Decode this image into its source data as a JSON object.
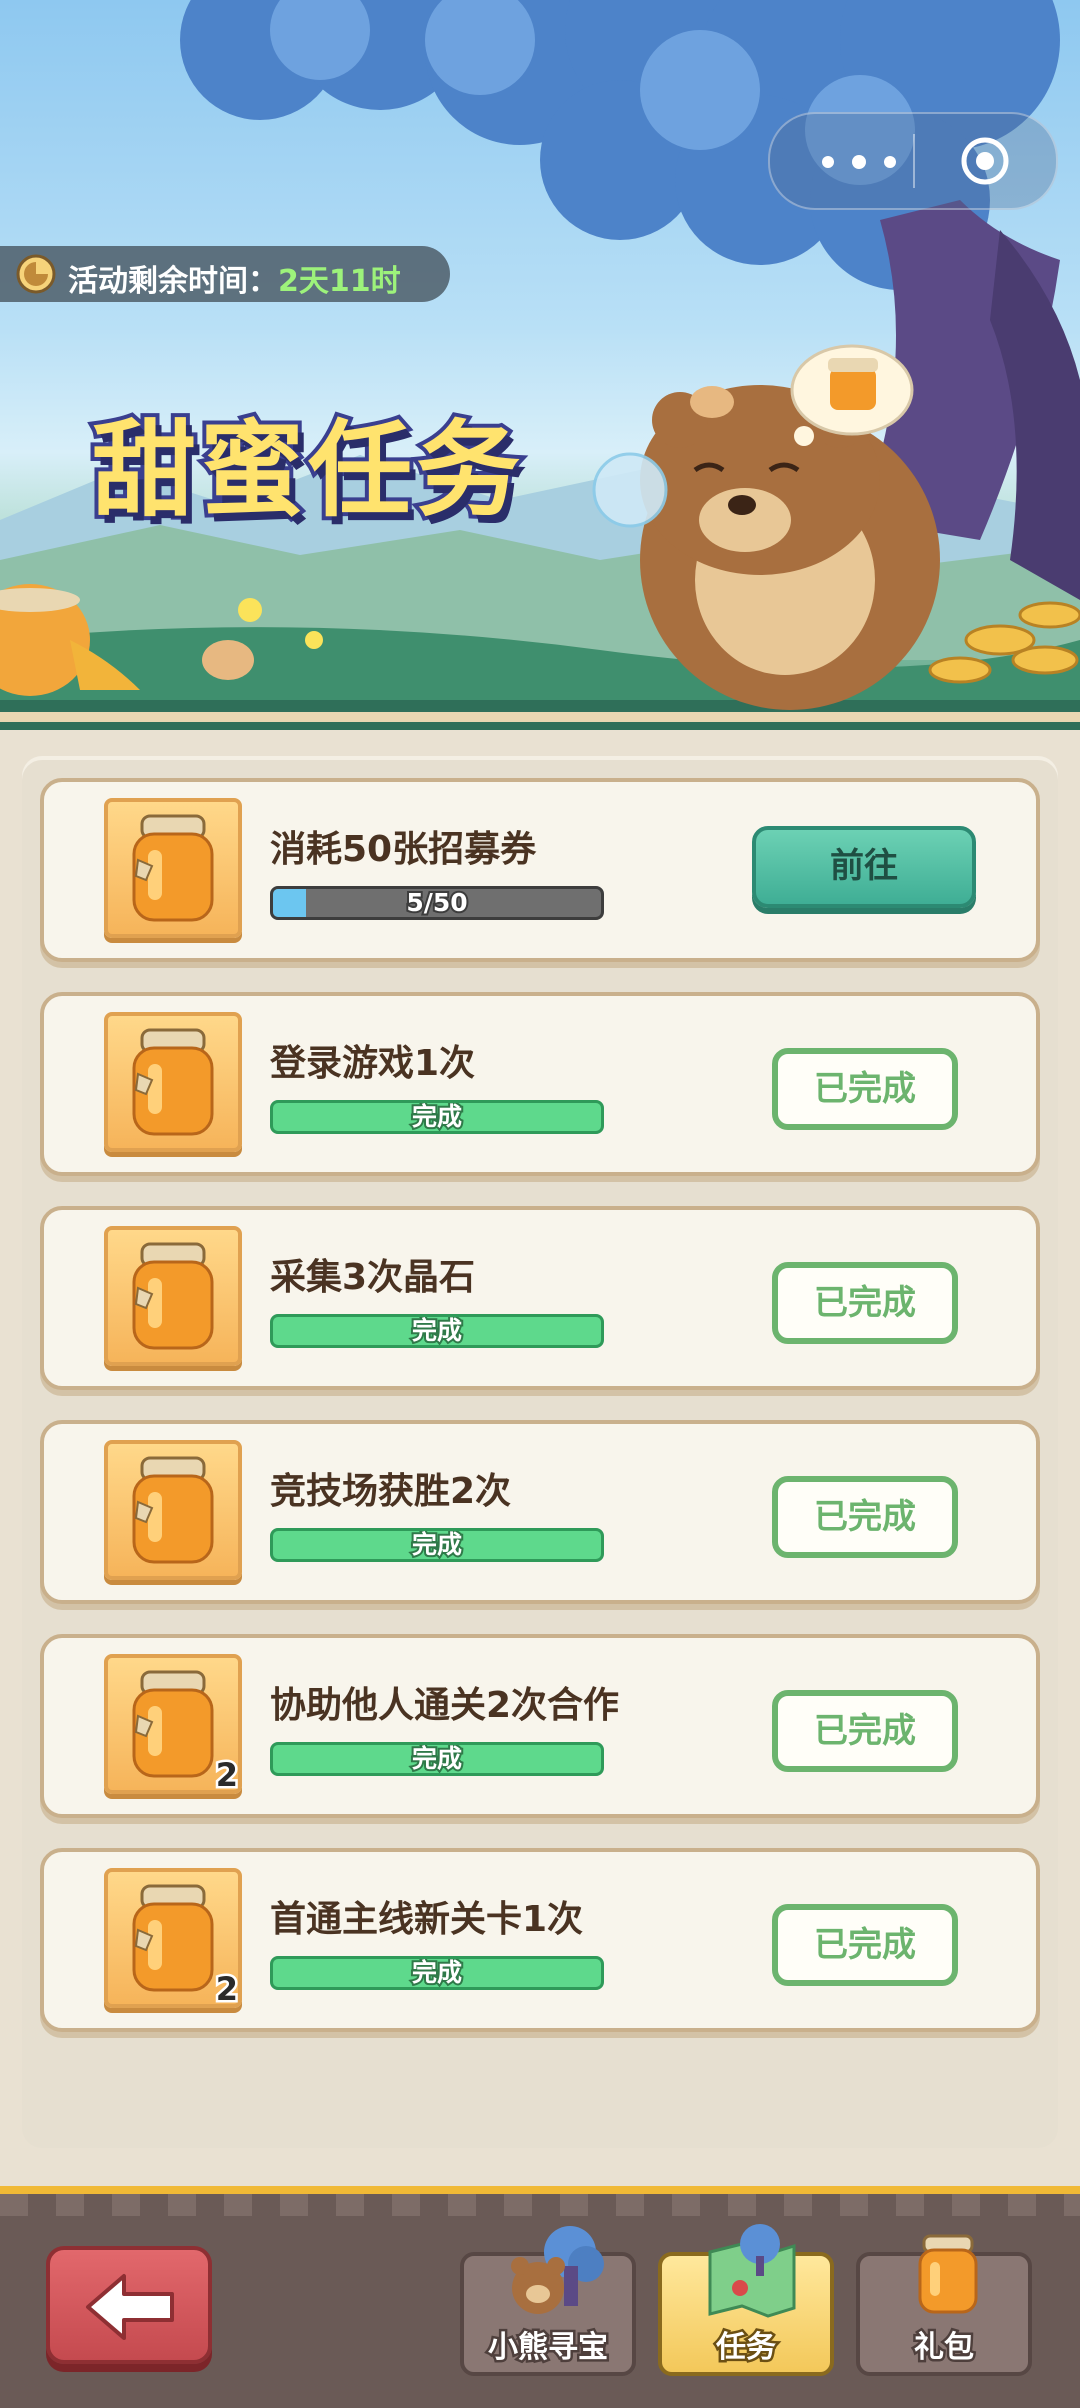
{
  "banner": {
    "timer_label": "活动剩余时间：",
    "timer_value": "2天11时",
    "title": "甜蜜任务"
  },
  "capsule": {
    "more_icon": "more-dots-icon",
    "close_icon": "target-circle-icon"
  },
  "tasks": [
    {
      "name": "消耗50张招募券",
      "progress_text": "5/50",
      "progress": 0.1,
      "status": "in_progress",
      "button": "前往",
      "reward_count": ""
    },
    {
      "name": "登录游戏1次",
      "progress_text": "完成",
      "progress": 1,
      "status": "done",
      "button": "已完成",
      "reward_count": ""
    },
    {
      "name": "采集3次晶石",
      "progress_text": "完成",
      "progress": 1,
      "status": "done",
      "button": "已完成",
      "reward_count": ""
    },
    {
      "name": "竞技场获胜2次",
      "progress_text": "完成",
      "progress": 1,
      "status": "done",
      "button": "已完成",
      "reward_count": ""
    },
    {
      "name": "协助他人通关2次合作",
      "progress_text": "完成",
      "progress": 1,
      "status": "done",
      "button": "已完成",
      "reward_count": "2"
    },
    {
      "name": "首通主线新关卡1次",
      "progress_text": "完成",
      "progress": 1,
      "status": "done",
      "button": "已完成",
      "reward_count": "2"
    }
  ],
  "nav": {
    "back_icon": "back-arrow-icon",
    "tabs": [
      {
        "label": "小熊寻宝",
        "icon": "bear-tree-icon",
        "active": false
      },
      {
        "label": "任务",
        "icon": "task-map-icon",
        "active": true
      },
      {
        "label": "礼包",
        "icon": "honey-jar-icon",
        "active": false
      }
    ]
  },
  "colors": {
    "accent": "#f0b936",
    "go_button": "#3fae95",
    "done_button": "#6cb46e",
    "back_button": "#c54a4f"
  }
}
